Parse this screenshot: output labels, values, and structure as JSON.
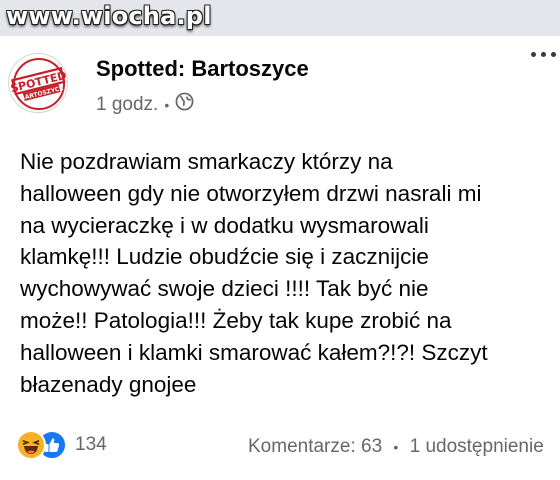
{
  "watermark": "www.wiocha.pl",
  "post": {
    "author": "Spotted: Bartoszyce",
    "time": "1 godz.",
    "separator": "•",
    "avatar_text_top": "SPOTTED",
    "avatar_text_bottom": "BARTOSZYCE",
    "text_lines": [
      "Nie pozdrawiam smarkaczy którzy na",
      "halloween gdy nie otworzyłem drzwi nasrali mi",
      "na wycieraczkę i w dodatku wysmarowali",
      "klamkę!!! Ludzie obudźcie się i zacznijcie",
      "wychowywać swoje dzieci !!!! Tak być nie",
      "może!! Patologia!!! Żeby tak kupe zrobić na",
      "halloween i klamki smarować kałem?!?! Szczyt",
      "błazenady gnojee"
    ]
  },
  "footer": {
    "reaction_count": "134",
    "comments": "Komentarze: 63",
    "separator": "•",
    "shares": "1 udostępnienie"
  },
  "icons": {
    "privacy": "globe-icon",
    "menu": "more-options-icon",
    "reactions": [
      "haha-icon",
      "like-icon"
    ]
  },
  "colors": {
    "avatar_red": "#c8202a",
    "like_blue": "#1877f2",
    "haha_yellow": "#f7b125",
    "secondary_text": "#65676b"
  }
}
